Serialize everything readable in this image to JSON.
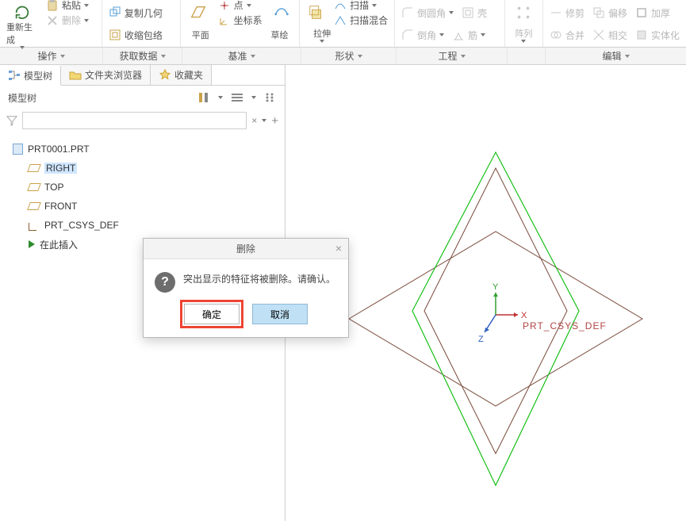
{
  "ribbon": {
    "groups": [
      {
        "name": "operate",
        "label": "操作",
        "big_label": "重新生成",
        "items": [
          "粘贴",
          "删除"
        ],
        "items2": [
          "复制几何",
          "收缩包络"
        ]
      },
      {
        "name": "datum",
        "label": "获取数据",
        "big_label": "平面",
        "items": [
          "点",
          "坐标系"
        ],
        "big_label2": "草绘"
      },
      {
        "name": "base",
        "label": "基准"
      },
      {
        "name": "shape",
        "label": "形状",
        "big_label": "拉伸",
        "items": [
          "扫描",
          "扫描混合"
        ]
      },
      {
        "name": "eng",
        "label": "工程",
        "items": [
          "倒圆角",
          "倒角",
          "筋",
          "壳"
        ]
      },
      {
        "name": "pattern",
        "label": "阵列",
        "big_label": "阵列"
      },
      {
        "name": "edit",
        "label": "编辑",
        "items": [
          "修剪",
          "合并",
          "偏移",
          "相交",
          "加厚",
          "实体化"
        ]
      }
    ]
  },
  "sidebar": {
    "tabs": [
      {
        "id": "modeltree",
        "label": "模型树"
      },
      {
        "id": "folder",
        "label": "文件夹浏览器"
      },
      {
        "id": "fav",
        "label": "收藏夹"
      }
    ],
    "tree_title": "模型树",
    "filter_value": "",
    "root": "PRT0001.PRT",
    "nodes": [
      {
        "type": "plane",
        "label": "RIGHT",
        "selected": true
      },
      {
        "type": "plane",
        "label": "TOP"
      },
      {
        "type": "plane",
        "label": "FRONT"
      },
      {
        "type": "csys",
        "label": "PRT_CSYS_DEF"
      },
      {
        "type": "insert",
        "label": "在此插入"
      }
    ]
  },
  "dialog": {
    "title": "删除",
    "message": "突出显示的特征将被删除。请确认。",
    "ok": "确定",
    "cancel": "取消"
  },
  "viewport": {
    "csys_label": "PRT_CSYS_DEF",
    "axes": {
      "x": "X",
      "y": "Y",
      "z": "Z"
    }
  }
}
